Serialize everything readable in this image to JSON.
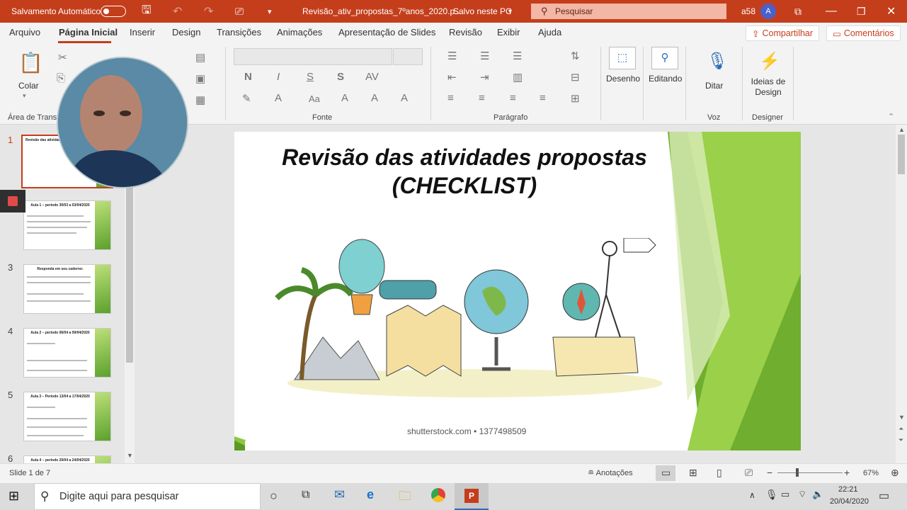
{
  "titlebar": {
    "autosave_label": "Salvamento Automático",
    "filename": "Revisão_ativ_propostas_7ºanos_2020.p...",
    "saved": "Salvo neste PC",
    "search_placeholder": "Pesquisar",
    "user": "a58",
    "avatar": "A"
  },
  "menu": {
    "tabs": [
      "Arquivo",
      "Página Inicial",
      "Inserir",
      "Design",
      "Transições",
      "Animações",
      "Apresentação de Slides",
      "Revisão",
      "Exibir",
      "Ajuda"
    ],
    "share": "Compartilhar",
    "comments": "Comentários"
  },
  "ribbon": {
    "paste": "Colar",
    "clipboard": "Área de Transf",
    "font_group": "Fonte",
    "paragraph_group": "Parágrafo",
    "draw": "Desenho",
    "edit": "Editando",
    "dictate": "Ditar",
    "voice_group": "Voz",
    "design_ideas": "Ideias de Design",
    "designer_group": "Designer",
    "bold": "N",
    "italic": "I",
    "underline": "S",
    "shadow": "S"
  },
  "thumbnails": [
    {
      "num": "1",
      "title": "Revisão das atividades propostas (CHECKLIST)"
    },
    {
      "num": "2",
      "title": "Aula 1 – período 30/03 a 03/04/2020"
    },
    {
      "num": "3",
      "title": "Responda em seu caderno:"
    },
    {
      "num": "4",
      "title": "Aula 2 – período 06/04 a 09/04/2020"
    },
    {
      "num": "5",
      "title": "Aula 3 – Período 13/04 a 17/04/2020"
    },
    {
      "num": "6",
      "title": "Aula 4 – período 20/04 a 24/04/2020"
    }
  ],
  "slide": {
    "title_line1": "Revisão das atividades propostas",
    "title_line2": "(CHECKLIST)",
    "credit": "shutterstock.com • 1377498509"
  },
  "status": {
    "slide_info": "Slide 1 de 7",
    "notes": "Anotações",
    "zoom": "67%"
  },
  "taskbar": {
    "search": "Digite aqui para pesquisar",
    "time": "22:21",
    "date": "20/04/2020"
  }
}
